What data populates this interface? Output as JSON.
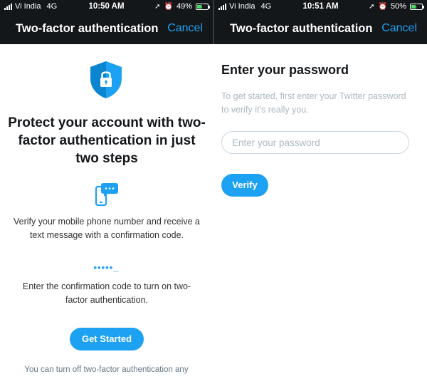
{
  "left_screen": {
    "status": {
      "carrier": "Vi India",
      "network": "4G",
      "time": "10:50 AM",
      "battery": "49%",
      "battery_level": 0.49
    },
    "nav": {
      "title": "Two-factor authentication",
      "cancel": "Cancel"
    },
    "headline": "Protect your account with two-factor authentication in just two steps",
    "step1_text": "Verify your mobile phone number and receive a text message with a confirmation code.",
    "code_dots": "•••••_",
    "step2_text": "Enter the confirmation code to turn on two-factor authentication.",
    "button": "Get Started",
    "footnote": "You can turn off two-factor authentication any",
    "icons": {
      "shield": "shield-lock-icon",
      "phone": "phone-message-icon"
    }
  },
  "right_screen": {
    "status": {
      "carrier": "Vi India",
      "network": "4G",
      "time": "10:51 AM",
      "battery": "50%",
      "battery_level": 0.5
    },
    "nav": {
      "title": "Two-factor authentication",
      "cancel": "Cancel"
    },
    "title": "Enter your password",
    "subtitle": "To get started, first enter your Twitter password to verify it’s really you.",
    "password_placeholder": "Enter your password",
    "password_value": "",
    "button": "Verify"
  },
  "colors": {
    "accent": "#1da1f2",
    "header_bg": "#14171a",
    "battery_green": "#4cd964"
  }
}
